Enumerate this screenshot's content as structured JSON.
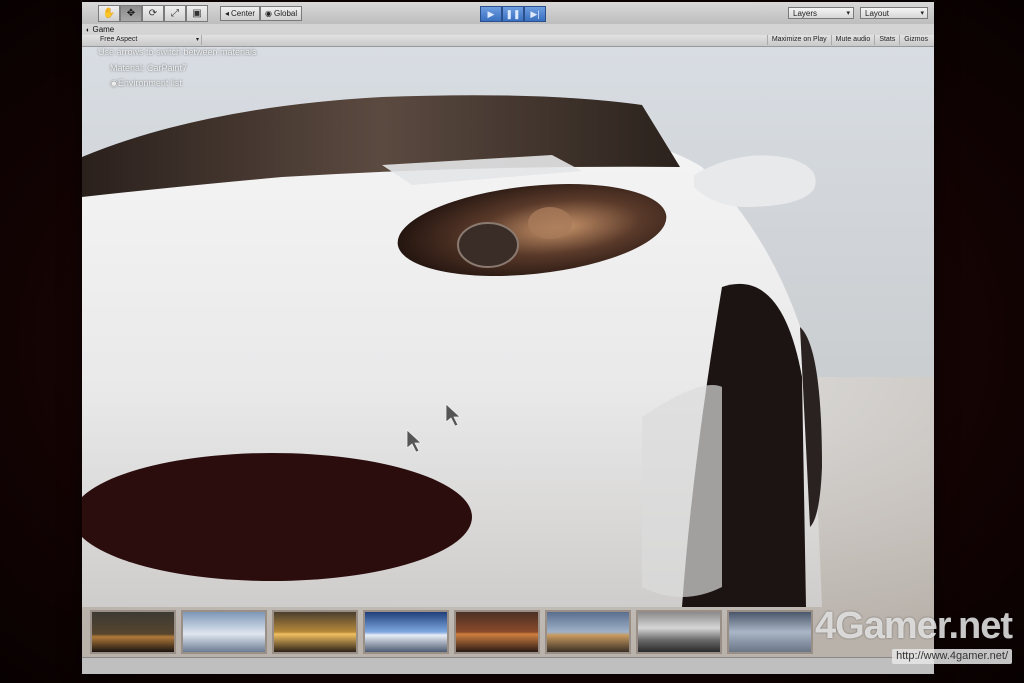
{
  "toolbar": {
    "tools": [
      "hand-icon",
      "move-icon",
      "rotate-icon",
      "scale-icon",
      "rect-icon"
    ],
    "pivot_center": "Center",
    "pivot_global": "Global",
    "play_buttons": [
      "play-icon",
      "pause-icon",
      "step-icon"
    ],
    "layers_label": "Layers",
    "layout_label": "Layout"
  },
  "game_view": {
    "tab_label": "Game",
    "aspect": "Free Aspect",
    "options": [
      "Maximize on Play",
      "Mute audio",
      "Stats",
      "Gizmos"
    ]
  },
  "hud": {
    "hint": "Use arrows to switch between materials",
    "material": "Material: CarPaint7",
    "environment": "Environment list"
  },
  "environment_thumbnails": [
    "sunset-dark",
    "cloudy-sky",
    "golden-sunset",
    "blue-sky",
    "red-dusk",
    "horizon-clouds",
    "interior-reflect",
    "stormy-sky"
  ],
  "colors": {
    "play_blue": "#3a6fc0",
    "car_body": "#f2f2f2",
    "background": "#1a0505"
  },
  "watermark": {
    "logo": "4Gamer.net",
    "url": "http://www.4gamer.net/"
  }
}
